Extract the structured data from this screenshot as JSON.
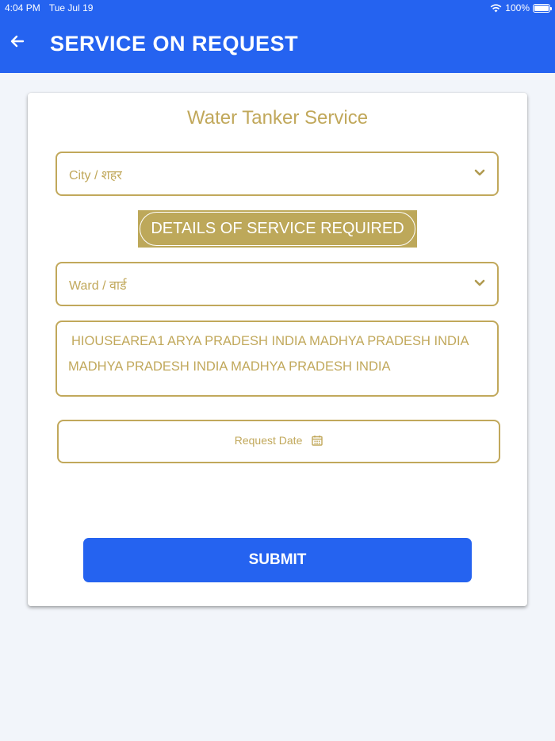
{
  "status_bar": {
    "time": "4:04 PM",
    "date": "Tue Jul 19",
    "battery": "100%"
  },
  "header": {
    "title": "SERVICE ON REQUEST"
  },
  "card": {
    "title": "Water Tanker Service",
    "city_select": {
      "placeholder": "City / शहर"
    },
    "section_label": "DETAILS OF SERVICE REQUIRED",
    "ward_select": {
      "placeholder": "Ward / वार्ड"
    },
    "address_text": "HIOUSEAREA1 ARYA PRADESH INDIA MADHYA PRADESH INDIA MADHYA PRADESH INDIA MADHYA PRADESH INDIA",
    "request_date": {
      "placeholder": "Request Date"
    },
    "submit_label": "SUBMIT"
  },
  "colors": {
    "brand_blue": "#2563f0",
    "accent_gold": "#c1a85b",
    "background": "#f2f5fa"
  },
  "icons": [
    "back-arrow-icon",
    "wifi-icon",
    "battery-icon",
    "chevron-down-icon",
    "calendar-icon"
  ]
}
